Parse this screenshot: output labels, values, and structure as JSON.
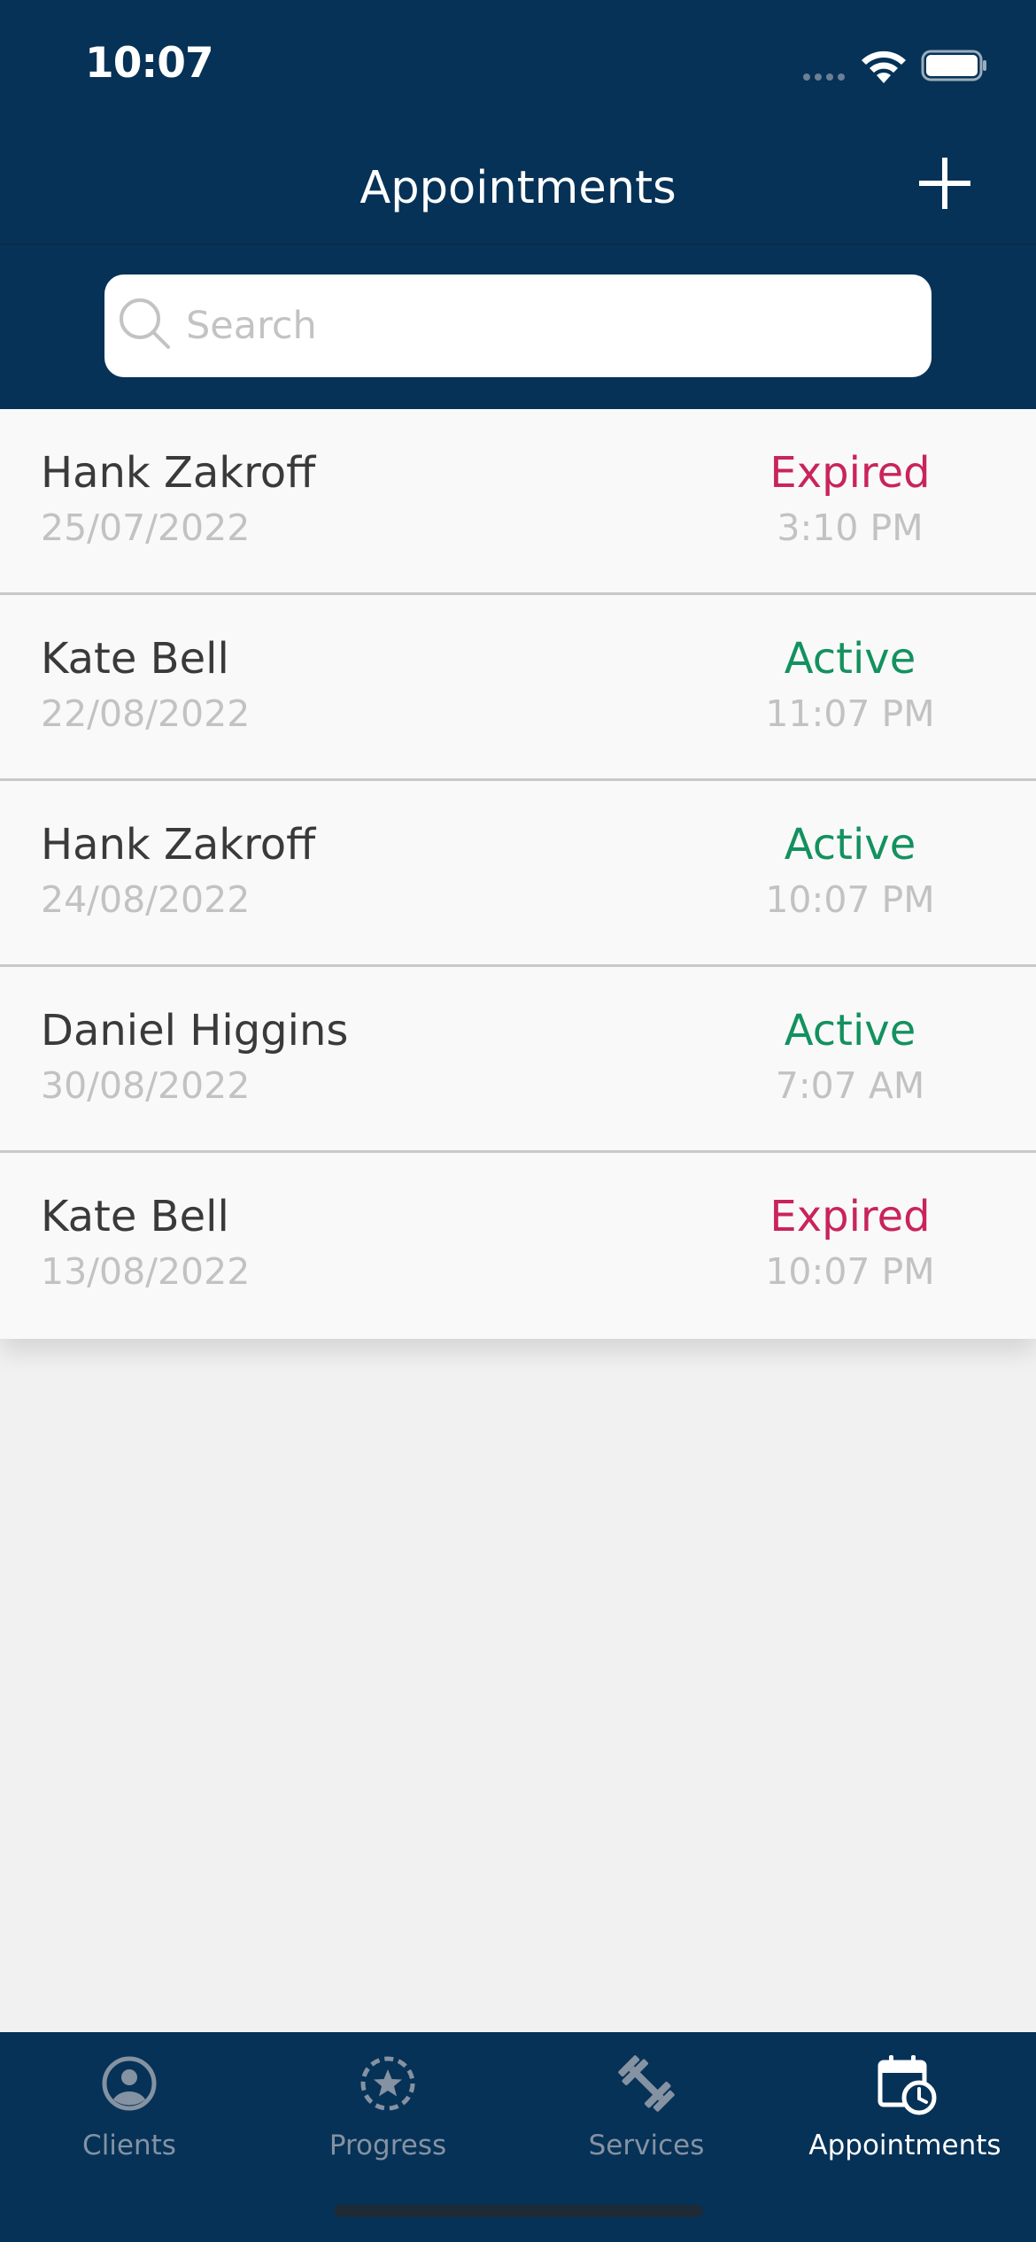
{
  "status_bar": {
    "time": "10:07"
  },
  "header": {
    "title": "Appointments",
    "add_icon": "plus-icon"
  },
  "search": {
    "placeholder": "Search",
    "icon": "search-icon"
  },
  "appointments": [
    {
      "name": "Hank Zakroff",
      "date": "25/07/2022",
      "status": "Expired",
      "time": "3:10 PM"
    },
    {
      "name": "Kate Bell",
      "date": "22/08/2022",
      "status": "Active",
      "time": "11:07 PM"
    },
    {
      "name": "Hank Zakroff",
      "date": "24/08/2022",
      "status": "Active",
      "time": "10:07 PM"
    },
    {
      "name": "Daniel Higgins",
      "date": "30/08/2022",
      "status": "Active",
      "time": "7:07 AM"
    },
    {
      "name": "Kate Bell",
      "date": "13/08/2022",
      "status": "Expired",
      "time": "10:07 PM"
    }
  ],
  "tabs": [
    {
      "label": "Clients",
      "icon": "user-circle-icon",
      "active": false
    },
    {
      "label": "Progress",
      "icon": "star-badge-icon",
      "active": false
    },
    {
      "label": "Services",
      "icon": "dumbbell-icon",
      "active": false
    },
    {
      "label": "Appointments",
      "icon": "calendar-clock-icon",
      "active": true
    }
  ],
  "colors": {
    "header_bg": "#063257",
    "expired": "#c9245b",
    "active": "#13915e",
    "tab_inactive": "#8592a2",
    "tab_active": "#ffffff"
  }
}
